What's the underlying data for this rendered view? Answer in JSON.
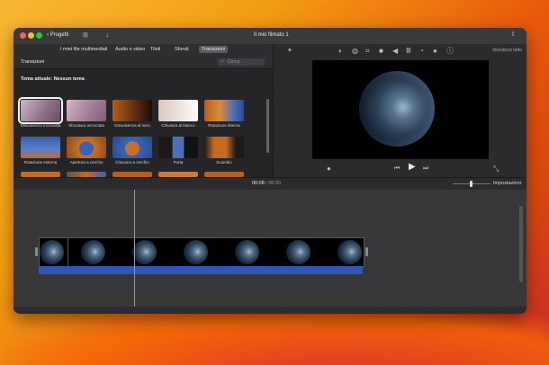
{
  "window": {
    "title": "Il mio filmato 1",
    "back_label": "Progetti"
  },
  "tabs": [
    {
      "label": "I miei file multimediali",
      "active": false
    },
    {
      "label": "Audio e video",
      "active": false
    },
    {
      "label": "Titoli",
      "active": false
    },
    {
      "label": "Sfondi",
      "active": false
    },
    {
      "label": "Transizioni",
      "active": true
    }
  ],
  "browser": {
    "heading": "Transizioni",
    "search_placeholder": "Cerca",
    "theme_label": "Tema attuale: Nessun tema",
    "transitions": [
      {
        "label": "Dissolvenza incrociata",
        "selected": true
      },
      {
        "label": "Sfocatura incrociata",
        "selected": false
      },
      {
        "label": "Dissolvenza al nero",
        "selected": false
      },
      {
        "label": "Chiusura al bianco",
        "selected": false
      },
      {
        "label": "Rotazione interna",
        "selected": false
      },
      {
        "label": "Rotazione esterna",
        "selected": false
      },
      {
        "label": "Apertura a cerchio",
        "selected": false
      },
      {
        "label": "Chiusura a cerchio",
        "selected": false
      },
      {
        "label": "Porta",
        "selected": false
      },
      {
        "label": "Scambio",
        "selected": false
      }
    ]
  },
  "viewer": {
    "restore_label": "Inizializza tutto"
  },
  "timebar": {
    "current": "00:08",
    "separator": "/",
    "total": "00:30",
    "settings_label": "Impostazioni"
  },
  "colors": {
    "accent": "#2f56b8",
    "window_bg": "#2b2b2d",
    "timeline_bg": "#373739"
  }
}
